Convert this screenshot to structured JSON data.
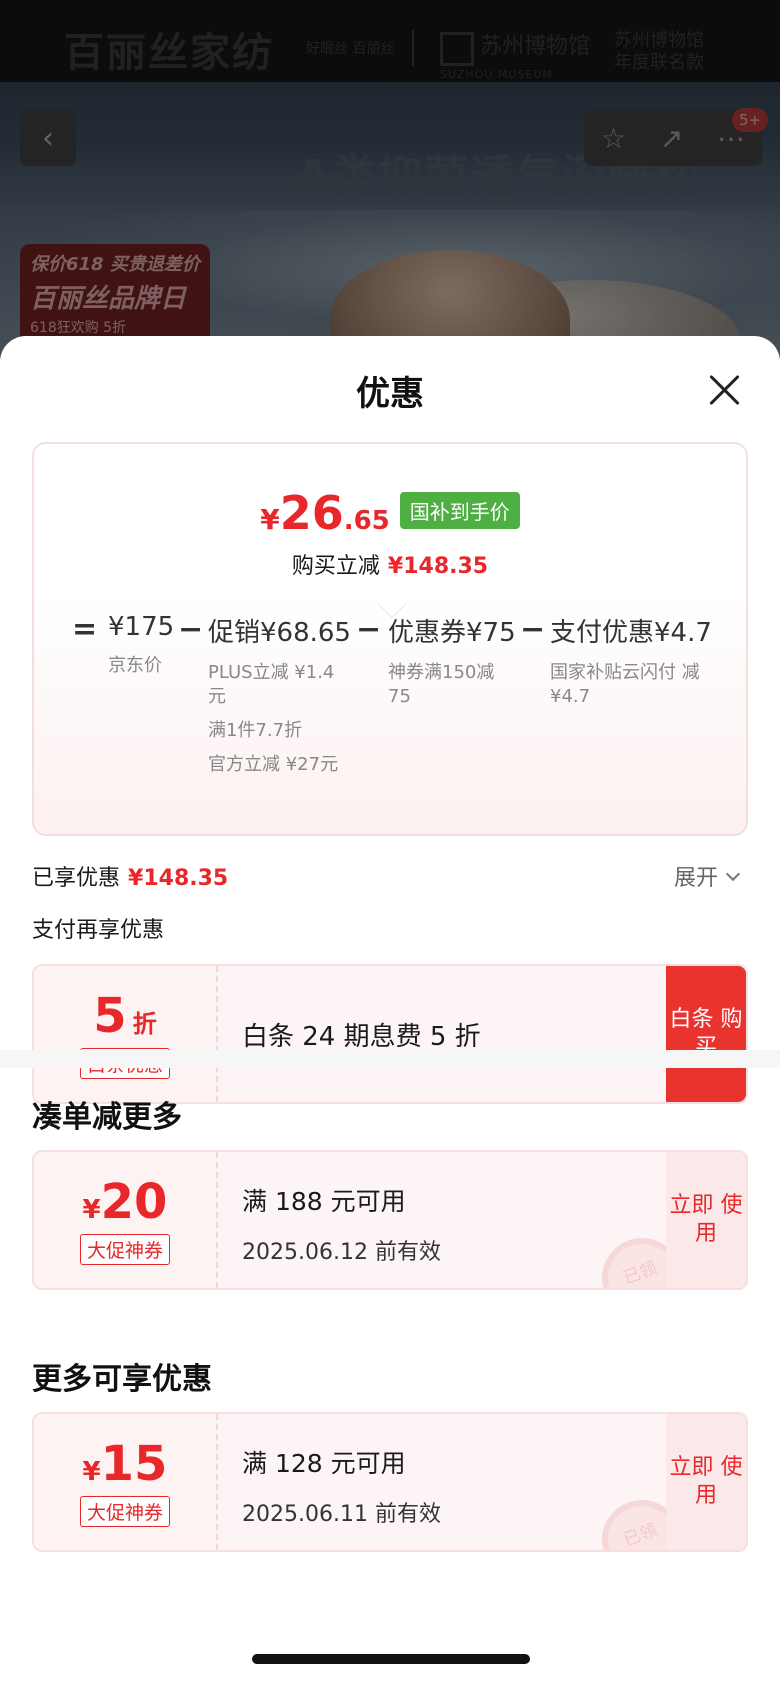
{
  "background": {
    "brand_left": "百丽丝家纺",
    "brand_left_sub": "好眠丝 百丽丝",
    "brand_right": "苏州博物馆",
    "brand_right_en": "SUZHOU MUSEUM",
    "brand_right_extra": "苏州博物馆 年度联名款",
    "headline": "A类抑菌透气深睡枕",
    "promo_line1": "保价618 买贵退差价",
    "promo_line2": "百丽丝品牌日",
    "promo_line3": "618狂欢购 5折",
    "cart_badge": "5+"
  },
  "sheet": {
    "title": "优惠",
    "summary": {
      "price_symbol": "¥",
      "price_int": "26",
      "price_dec": ".65",
      "price_tag": "国补到手价",
      "buy_reduce_label": "购买立减",
      "buy_reduce_value": "¥148.35",
      "breakdown": {
        "eq": "=",
        "jd_price": "¥175",
        "jd_price_label": "京东价",
        "minus": "−",
        "promo_head": "促销¥68.65",
        "promo_items": [
          "PLUS立减 ¥1.4元",
          "满1件7.7折",
          "官方立减 ¥27元"
        ],
        "coupon_head": "优惠券¥75",
        "coupon_items": [
          "神券满150减 75"
        ],
        "pay_head": "支付优惠¥4.7",
        "pay_items": [
          "国家补贴云闪付 减¥4.7"
        ]
      }
    },
    "enjoyed_label": "已享优惠",
    "enjoyed_value": "¥148.35",
    "expand_label": "展开",
    "pay_more_label": "支付再享优惠",
    "baitiao": {
      "amount": "5",
      "unit": "折",
      "tag": "白条优惠",
      "desc": "白条 24 期息费 5 折",
      "action": "白条 购买"
    },
    "section_more": "凑单减更多",
    "coupon1": {
      "symbol": "¥",
      "amount": "20",
      "tag": "大促神券",
      "condition": "满 188 元可用",
      "expiry": "2025.06.12 前有效",
      "action": "立即 使用",
      "stamp": "已领"
    },
    "section_other": "更多可享优惠",
    "coupon2": {
      "symbol": "¥",
      "amount": "15",
      "tag": "大促神券",
      "condition": "满 128 元可用",
      "expiry": "2025.06.11 前有效",
      "action": "立即 使用",
      "stamp": "已领"
    }
  }
}
